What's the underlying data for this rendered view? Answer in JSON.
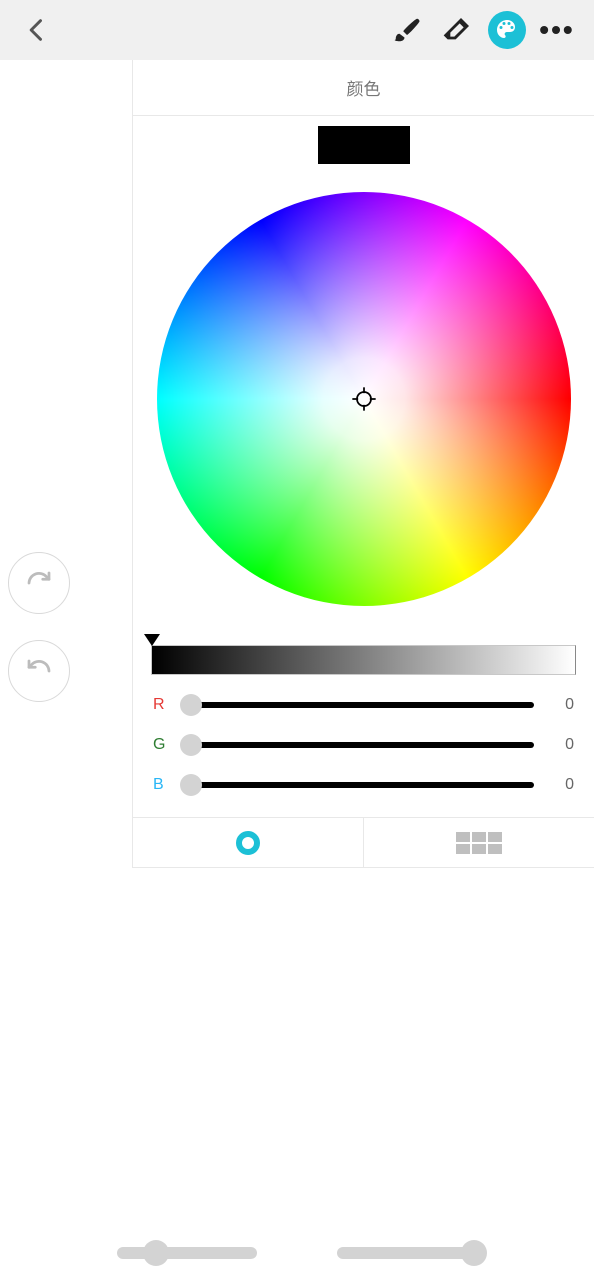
{
  "panel": {
    "title": "颜色",
    "current_color": "#000000"
  },
  "rgb": {
    "r": {
      "label": "R",
      "value": 0
    },
    "g": {
      "label": "G",
      "value": 0
    },
    "b": {
      "label": "B",
      "value": 0
    }
  },
  "bottom_sliders": {
    "left_pos_pct": 28,
    "right_pos_pct": 98
  }
}
